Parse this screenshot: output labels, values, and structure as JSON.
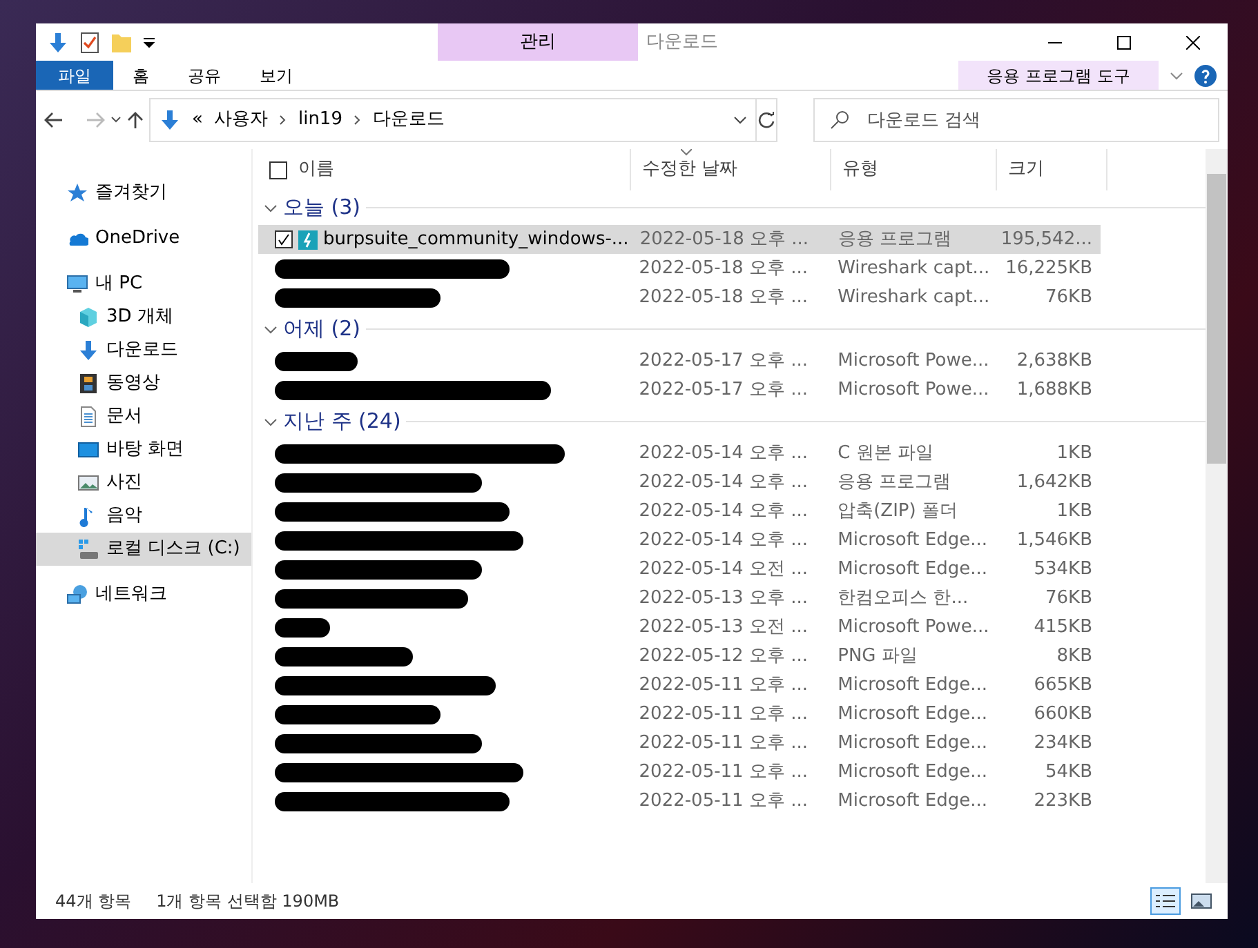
{
  "ribbon": {
    "contextual_group": "관리",
    "tabs": [
      {
        "label": "파일",
        "kind": "file",
        "selected": false
      },
      {
        "label": "홈",
        "kind": "plain",
        "selected": false
      },
      {
        "label": "공유",
        "kind": "plain",
        "selected": false
      },
      {
        "label": "보기",
        "kind": "plain",
        "selected": false
      },
      {
        "label": "응용 프로그램 도구",
        "kind": "contextual",
        "selected": false
      }
    ]
  },
  "window": {
    "title": "다운로드"
  },
  "address": {
    "overflow": "«",
    "path": [
      "사용자",
      "lin19",
      "다운로드"
    ]
  },
  "search": {
    "placeholder": "다운로드 검색"
  },
  "sidebar": {
    "items": [
      {
        "label": "즐겨찾기",
        "selected": false
      },
      {
        "label": "OneDrive",
        "selected": false
      },
      {
        "label": "내 PC",
        "selected": false,
        "children": [
          {
            "label": "3D 개체",
            "selected": false
          },
          {
            "label": "다운로드",
            "selected": false
          },
          {
            "label": "동영상",
            "selected": false
          },
          {
            "label": "문서",
            "selected": false
          },
          {
            "label": "바탕 화면",
            "selected": false
          },
          {
            "label": "사진",
            "selected": false
          },
          {
            "label": "음악",
            "selected": false
          },
          {
            "label": "로컬 디스크 (C:)",
            "selected": true
          }
        ]
      },
      {
        "label": "네트워크",
        "selected": false
      }
    ]
  },
  "table": {
    "select_all": false,
    "columns": [
      {
        "label": "이름",
        "sorted": false
      },
      {
        "label": "수정한 날짜",
        "sorted": true
      },
      {
        "label": "유형",
        "sorted": false
      },
      {
        "label": "크기",
        "sorted": false
      }
    ],
    "groups": [
      {
        "label": "오늘 (3)",
        "rows": [
          {
            "name": "burpsuite_community_windows-...",
            "redacted": false,
            "selected": true,
            "date": "2022-05-18 오후 ...",
            "type": "응용 프로그램",
            "size": "195,542..."
          },
          {
            "redacted": true,
            "selected": false,
            "date": "2022-05-18 오후 ...",
            "type": "Wireshark capt...",
            "size": "16,225KB"
          },
          {
            "redacted": true,
            "selected": false,
            "date": "2022-05-18 오후 ...",
            "type": "Wireshark capt...",
            "size": "76KB"
          }
        ]
      },
      {
        "label": "어제 (2)",
        "rows": [
          {
            "redacted": true,
            "selected": false,
            "date": "2022-05-17 오후 ...",
            "type": "Microsoft Powe...",
            "size": "2,638KB"
          },
          {
            "redacted": true,
            "selected": false,
            "date": "2022-05-17 오후 ...",
            "type": "Microsoft Powe...",
            "size": "1,688KB"
          }
        ]
      },
      {
        "label": "지난 주 (24)",
        "rows": [
          {
            "redacted": true,
            "selected": false,
            "date": "2022-05-14 오후 ...",
            "type": "C 원본 파일",
            "size": "1KB"
          },
          {
            "redacted": true,
            "selected": false,
            "date": "2022-05-14 오후 ...",
            "type": "응용 프로그램",
            "size": "1,642KB"
          },
          {
            "redacted": true,
            "selected": false,
            "date": "2022-05-14 오후 ...",
            "type": "압축(ZIP) 폴더",
            "size": "1KB"
          },
          {
            "redacted": true,
            "selected": false,
            "date": "2022-05-14 오후 ...",
            "type": "Microsoft Edge...",
            "size": "1,546KB"
          },
          {
            "redacted": true,
            "selected": false,
            "date": "2022-05-14 오전 ...",
            "type": "Microsoft Edge...",
            "size": "534KB"
          },
          {
            "redacted": true,
            "selected": false,
            "date": "2022-05-13 오후 ...",
            "type": "한컴오피스 한...",
            "size": "76KB"
          },
          {
            "redacted": true,
            "selected": false,
            "date": "2022-05-13 오전 ...",
            "type": "Microsoft Powe...",
            "size": "415KB"
          },
          {
            "redacted": true,
            "selected": false,
            "date": "2022-05-12 오후 ...",
            "type": "PNG 파일",
            "size": "8KB"
          },
          {
            "redacted": true,
            "selected": false,
            "date": "2022-05-11 오후 ...",
            "type": "Microsoft Edge...",
            "size": "665KB"
          },
          {
            "redacted": true,
            "selected": false,
            "date": "2022-05-11 오후 ...",
            "type": "Microsoft Edge...",
            "size": "660KB"
          },
          {
            "redacted": true,
            "selected": false,
            "date": "2022-05-11 오후 ...",
            "type": "Microsoft Edge...",
            "size": "234KB"
          },
          {
            "redacted": true,
            "selected": false,
            "date": "2022-05-11 오후 ...",
            "type": "Microsoft Edge...",
            "size": "54KB"
          },
          {
            "redacted": true,
            "selected": false,
            "date": "2022-05-11 오후 ...",
            "type": "Microsoft Edge...",
            "size": "223KB"
          }
        ]
      }
    ]
  },
  "status_bar": {
    "item_count": "44개 항목",
    "selection": "1개 항목 선택함 190MB",
    "views": [
      {
        "kind": "details",
        "selected": true
      },
      {
        "kind": "large_icons",
        "selected": false
      }
    ]
  }
}
